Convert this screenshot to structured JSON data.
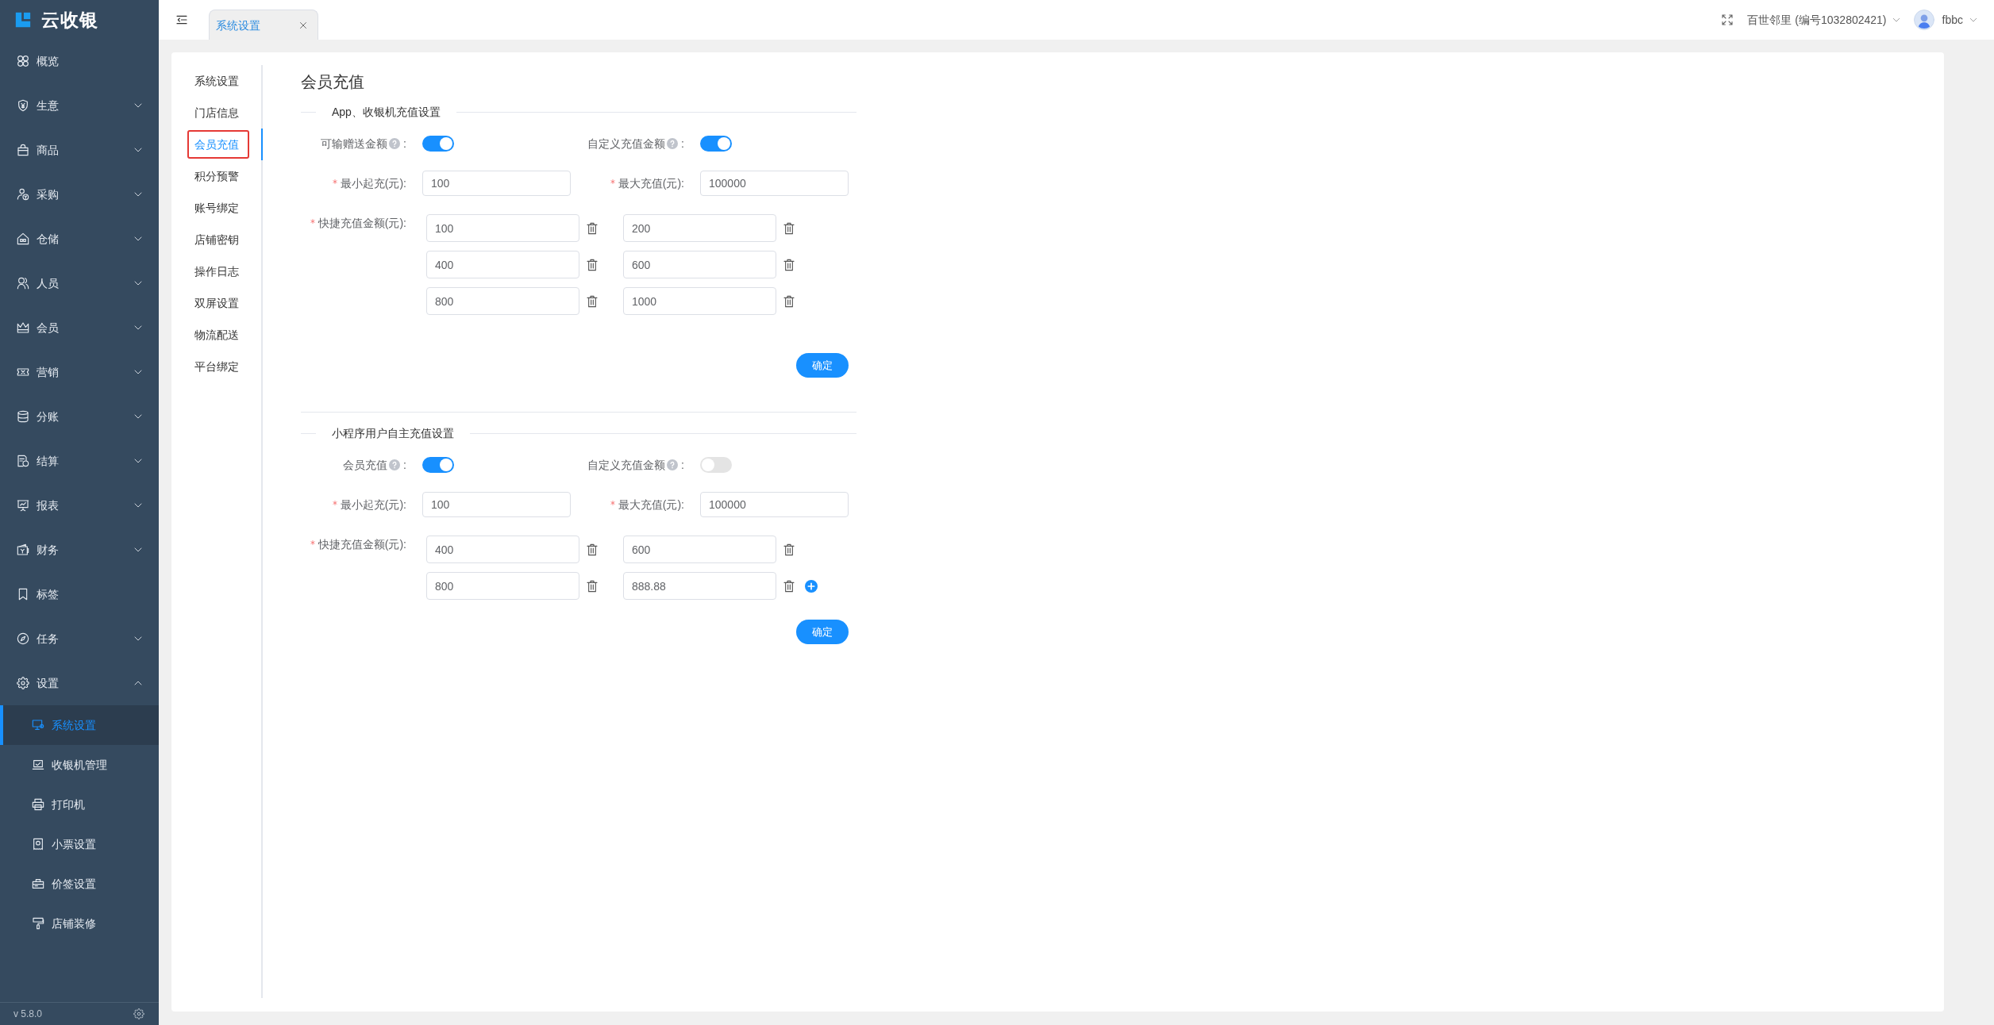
{
  "sidebar": {
    "logo": "云收银",
    "items": [
      {
        "label": "概览",
        "kind": "link",
        "selected": false
      },
      {
        "label": "生意",
        "kind": "group",
        "selected": false,
        "expanded": false
      },
      {
        "label": "商品",
        "kind": "group",
        "selected": false,
        "expanded": false
      },
      {
        "label": "采购",
        "kind": "group",
        "selected": false,
        "expanded": false
      },
      {
        "label": "仓储",
        "kind": "group",
        "selected": false,
        "expanded": false
      },
      {
        "label": "人员",
        "kind": "group",
        "selected": false,
        "expanded": false
      },
      {
        "label": "会员",
        "kind": "group",
        "selected": false,
        "expanded": false
      },
      {
        "label": "营销",
        "kind": "group",
        "selected": false,
        "expanded": false
      },
      {
        "label": "分账",
        "kind": "group",
        "selected": false,
        "expanded": false
      },
      {
        "label": "结算",
        "kind": "group",
        "selected": false,
        "expanded": false
      },
      {
        "label": "报表",
        "kind": "group",
        "selected": false,
        "expanded": false
      },
      {
        "label": "财务",
        "kind": "group",
        "selected": false,
        "expanded": false
      },
      {
        "label": "标签",
        "kind": "link",
        "selected": false
      },
      {
        "label": "任务",
        "kind": "group",
        "selected": false,
        "expanded": false
      },
      {
        "label": "设置",
        "kind": "group",
        "selected": false,
        "expanded": true,
        "children": [
          {
            "label": "系统设置",
            "selected": true
          },
          {
            "label": "收银机管理",
            "selected": false
          },
          {
            "label": "打印机",
            "selected": false
          },
          {
            "label": "小票设置",
            "selected": false
          },
          {
            "label": "价签设置",
            "selected": false
          },
          {
            "label": "店铺装修",
            "selected": false
          }
        ]
      }
    ],
    "version": "v 5.8.0"
  },
  "topbar": {
    "tabs": [
      {
        "label": "系统设置",
        "selected": true
      }
    ],
    "store": "百世邻里 (编号1032802421)",
    "user": "fbbc"
  },
  "settings_nav": [
    {
      "label": "系统设置",
      "selected": false,
      "highlighted": false
    },
    {
      "label": "门店信息",
      "selected": false,
      "highlighted": false
    },
    {
      "label": "会员充值",
      "selected": true,
      "highlighted": true
    },
    {
      "label": "积分预警",
      "selected": false,
      "highlighted": false
    },
    {
      "label": "账号绑定",
      "selected": false,
      "highlighted": false
    },
    {
      "label": "店铺密钥",
      "selected": false,
      "highlighted": false
    },
    {
      "label": "操作日志",
      "selected": false,
      "highlighted": false
    },
    {
      "label": "双屏设置",
      "selected": false,
      "highlighted": false
    },
    {
      "label": "物流配送",
      "selected": false,
      "highlighted": false
    },
    {
      "label": "平台绑定",
      "selected": false,
      "highlighted": false
    }
  ],
  "page": {
    "title": "会员充值",
    "sections": [
      {
        "title": "App、收银机充值设置",
        "toggles": [
          {
            "label": "可输赠送金额",
            "suffix": ":",
            "on": true
          },
          {
            "label": "自定义充值金额",
            "suffix": ":",
            "on": true
          }
        ],
        "limits": [
          {
            "label": "最小起充(元):",
            "required": true,
            "value": "100"
          },
          {
            "label": "最大充值(元):",
            "required": true,
            "value": "100000"
          }
        ],
        "quick": {
          "label": "快捷充值金额(元):",
          "required": true,
          "amounts": [
            "100",
            "200",
            "400",
            "600",
            "800",
            "1000"
          ],
          "add_button": false
        },
        "confirm": "确定"
      },
      {
        "title": "小程序用户自主充值设置",
        "toggles": [
          {
            "label": "会员充值",
            "suffix": ":",
            "on": true
          },
          {
            "label": "自定义充值金额",
            "suffix": ":",
            "on": false
          }
        ],
        "limits": [
          {
            "label": "最小起充(元):",
            "required": true,
            "value": "100"
          },
          {
            "label": "最大充值(元):",
            "required": true,
            "value": "100000"
          }
        ],
        "quick": {
          "label": "快捷充值金额(元):",
          "required": true,
          "amounts": [
            "400",
            "600",
            "800",
            "888.88"
          ],
          "add_button": true
        },
        "confirm": "确定"
      }
    ]
  }
}
